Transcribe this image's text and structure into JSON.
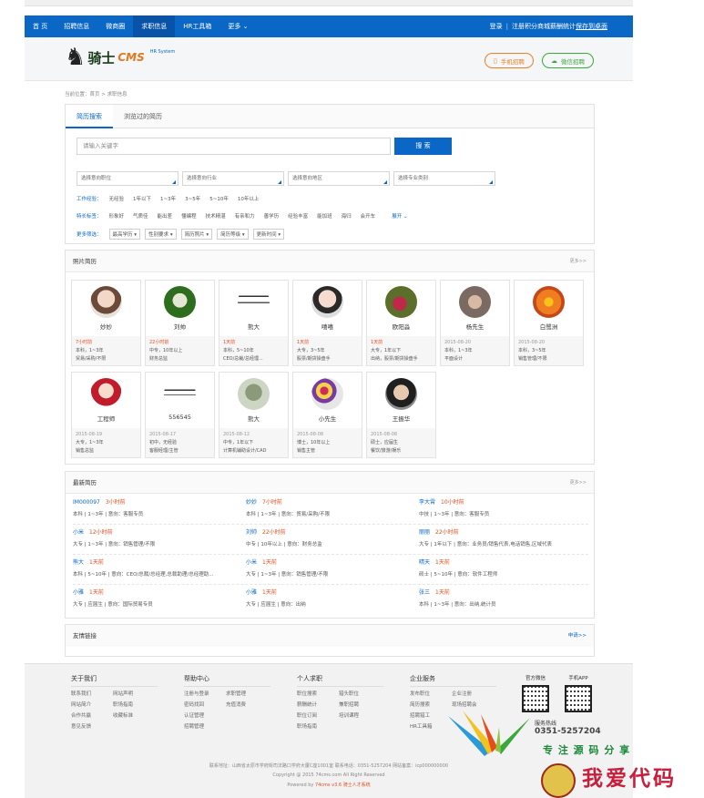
{
  "nav": {
    "items": [
      "首 页",
      "招聘信息",
      "微商圈",
      "求职信息",
      "HR工具箱",
      "更多"
    ],
    "active_index": 3,
    "login": "登录",
    "register": "注册",
    "points_mall": "积分商城",
    "salary_stats": "薪酬统计",
    "save_desktop": "保存到桌面"
  },
  "header": {
    "logo_text": "骑士",
    "logo_cms": "CMS",
    "logo_sub": "HR System",
    "mobile_btn": "手机招聘",
    "wechat_btn": "微信招聘"
  },
  "breadcrumb": "当前位置：首页 > 求职信息",
  "search": {
    "tabs": [
      "简历搜索",
      "浏览过的简历"
    ],
    "placeholder": "请输入关键字",
    "button": "搜 索",
    "selects": [
      "选择意向职位",
      "选择意向行业",
      "选择意向地区",
      "选择专业类别"
    ],
    "exp_label": "工作经验：",
    "exp_options": [
      "无经验",
      "1年以下",
      "1~3年",
      "3~5年",
      "5~10年",
      "10年以上"
    ],
    "tag_label": "特长标签：",
    "tag_options": [
      "形象好",
      "气质佳",
      "能出差",
      "懂编程",
      "技术精湛",
      "有亲和力",
      "善学历",
      "经验丰富",
      "能加班",
      "海归",
      "会开车"
    ],
    "expand": "展开",
    "more_label": "更多筛选：",
    "more_options": [
      "最高学历",
      "性别要求",
      "简历照片",
      "简历等级",
      "更新时间"
    ]
  },
  "photo": {
    "title": "照片简历",
    "more": "更多>>",
    "cards": [
      {
        "name": "妙妙",
        "time": "7小时前",
        "line1": "本科，1~3年",
        "line2": "贸易/采购/不限",
        "grey": false
      },
      {
        "name": "刘帅",
        "time": "22小时前",
        "line1": "中专，10年以上",
        "line2": "财务总监",
        "grey": false
      },
      {
        "name": "熊大",
        "time": "1天前",
        "line1": "本科，5~10年",
        "line2": "CEO/总裁/总经理...",
        "grey": false
      },
      {
        "name": "嘻嘻",
        "time": "1天前",
        "line1": "大专，3~5年",
        "line2": "股票/期货操盘手",
        "grey": false
      },
      {
        "name": "欧阳淼",
        "time": "1天前",
        "line1": "大专，1年以下",
        "line2": "出纳，股票/期货操盘手",
        "grey": false
      },
      {
        "name": "杨先生",
        "time": "2015-08-20",
        "line1": "本科，1~3年",
        "line2": "平面设计",
        "grey": true
      },
      {
        "name": "白鹭洲",
        "time": "2015-08-20",
        "line1": "本科，3~5年",
        "line2": "销售管理/不限",
        "grey": true
      },
      {
        "name": "工程师",
        "time": "2015-08-19",
        "line1": "大专，1~3年",
        "line2": "销售总监",
        "grey": true
      },
      {
        "name": "556545",
        "time": "2015-08-17",
        "line1": "初中，无经验",
        "line2": "客服经理/主管",
        "grey": true
      },
      {
        "name": "熊大",
        "time": "2015-08-12",
        "line1": "中专，1年以下",
        "line2": "计算机辅助设计/CAD",
        "grey": true
      },
      {
        "name": "小先生",
        "time": "2015-08-08",
        "line1": "博士，10年以上",
        "line2": "销售主管",
        "grey": true
      },
      {
        "name": "王振华",
        "time": "2015-08-08",
        "line1": "硕士，应届生",
        "line2": "餐饮/旅游/娱乐",
        "grey": true
      }
    ]
  },
  "latest": {
    "title": "最新简历",
    "more": "更多>>",
    "rows": [
      [
        {
          "name": "IM000097",
          "time": "3小时前",
          "desc": "本科 | 1~3年 | 意向：客服专员"
        },
        {
          "name": "妙妙",
          "time": "7小时前",
          "desc": "本科 | 1~3年 | 意向：贸易/采购/不限"
        },
        {
          "name": "李大霄",
          "time": "10小时前",
          "desc": "中技 | 1~3年 | 意向：客服专员"
        }
      ],
      [
        {
          "name": "小米",
          "time": "12小时前",
          "desc": "大专 | 1~3年 | 意向：销售管理/不限"
        },
        {
          "name": "刘帅",
          "time": "22小时前",
          "desc": "中专 | 10年以上 | 意向：财务总监"
        },
        {
          "name": "丽丽",
          "time": "22小时前",
          "desc": "大专 | 1年以下 | 意向：业务员/销售代表,电话销售,区域代表"
        }
      ],
      [
        {
          "name": "熊大",
          "time": "1天前",
          "desc": "本科 | 5~10年 | 意向：CEO/总裁/总经理,总裁助理/总经理助..."
        },
        {
          "name": "小米",
          "time": "1天前",
          "desc": "大专 | 1~3年 | 意向：销售管理/不限"
        },
        {
          "name": "晴天",
          "time": "1天前",
          "desc": "硕士 | 5~10年 | 意向：软件工程师"
        }
      ],
      [
        {
          "name": "小雅",
          "time": "1天前",
          "desc": "大专 | 应届生 | 意向：国际贸易专员"
        },
        {
          "name": "小雅",
          "time": "1天前",
          "desc": "大专 | 应届生 | 意向：出纳"
        },
        {
          "name": "张三",
          "time": "1天前",
          "desc": "本科 | 1~3年 | 意向：出纳,统计员"
        }
      ]
    ]
  },
  "links": {
    "title": "友情链接",
    "apply": "申请>>"
  },
  "footer": {
    "cols": [
      {
        "title": "关于我们",
        "links": [
          "联系我们",
          "网站声明",
          "网站简介",
          "职场指南",
          "合作共赢",
          "收藏标准",
          "意见反馈"
        ]
      },
      {
        "title": "帮助中心",
        "links": [
          "注册与登录",
          "求职管理",
          "密码找回",
          "充值消费",
          "认证管理",
          "",
          "招聘管理"
        ]
      },
      {
        "title": "个人求职",
        "links": [
          "职位搜索",
          "猎头职位",
          "薪酬统计",
          "兼职招聘",
          "职位订阅",
          "培训课程",
          "职场指南"
        ]
      },
      {
        "title": "企业服务",
        "links": [
          "发布职位",
          "企业注册",
          "简历搜索",
          "现场招聘会",
          "招聘猎工",
          "",
          "HR工具箱"
        ]
      }
    ],
    "qr1": "官方微信",
    "qr2": "手机APP",
    "hotline_label": "服务热线",
    "hotline": "0351-5257204",
    "address": "联系地址：山西省太原市学府街司法路口学府大厦C座1001室 联系电话：0351-5257204 网站备案：icp000000000",
    "copyright": "Copyright @ 2015 74cms.com All Right Reserved",
    "powered_prefix": "Powered by ",
    "powered_brand": "74cms v3.6 ",
    "powered_suffix": "骑士人才系统"
  },
  "watermark": {
    "line1": "专 注 源 码 分 享",
    "line2": "我爱代码"
  },
  "colors": {
    "primary": "#0a67c5",
    "accent": "#e84c1e",
    "wechat": "#3aa83a",
    "mobile": "#f07d22"
  }
}
